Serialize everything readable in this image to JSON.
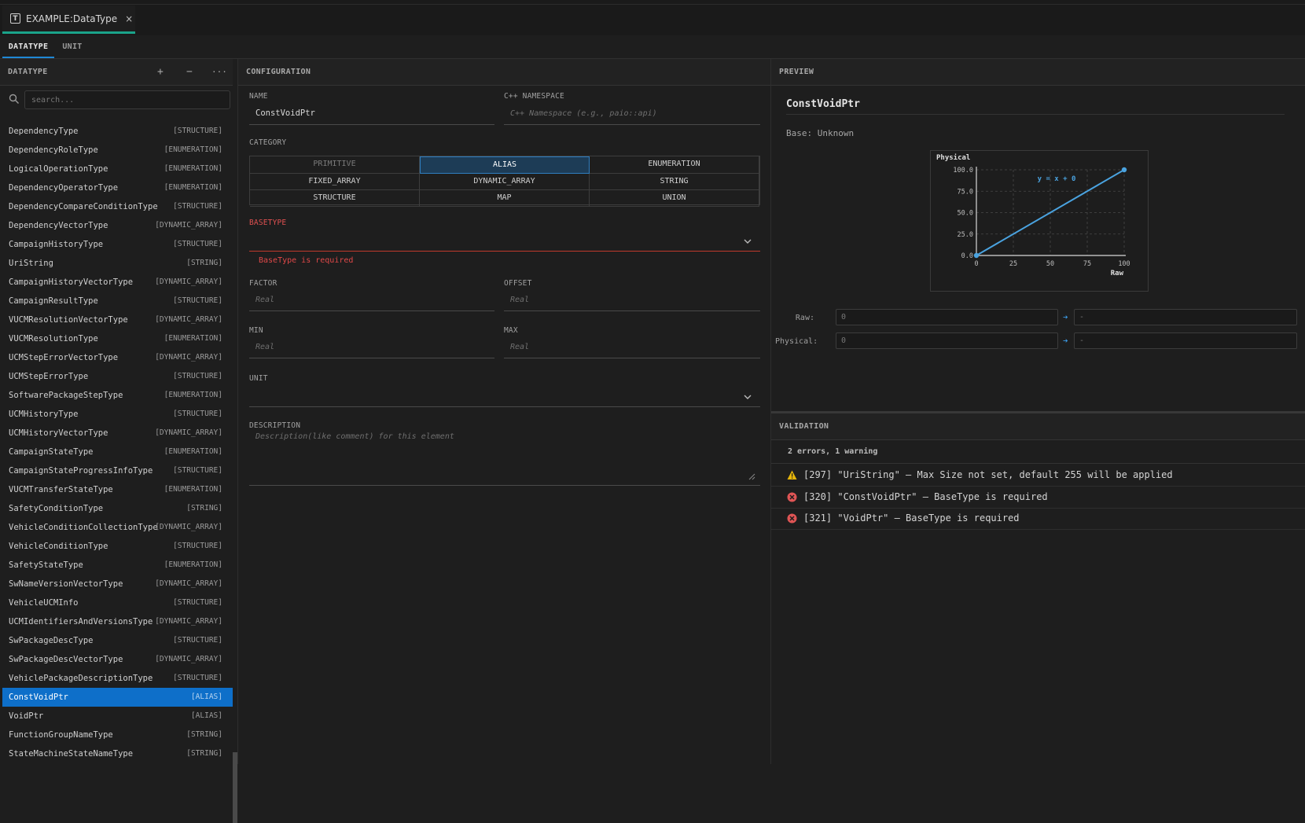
{
  "editor_tab": {
    "title": "EXAMPLE:DataType",
    "close": "×"
  },
  "subtabs": [
    "DATATYPE",
    "UNIT"
  ],
  "left": {
    "header": "DATATYPE",
    "add": "+",
    "remove": "−",
    "more": "···",
    "search_placeholder": "search...",
    "items": [
      {
        "name": "DependencyType",
        "type": "[STRUCTURE]"
      },
      {
        "name": "DependencyRoleType",
        "type": "[ENUMERATION]"
      },
      {
        "name": "LogicalOperationType",
        "type": "[ENUMERATION]"
      },
      {
        "name": "DependencyOperatorType",
        "type": "[ENUMERATION]"
      },
      {
        "name": "DependencyCompareConditionType",
        "type": "[STRUCTURE]"
      },
      {
        "name": "DependencyVectorType",
        "type": "[DYNAMIC_ARRAY]"
      },
      {
        "name": "CampaignHistoryType",
        "type": "[STRUCTURE]"
      },
      {
        "name": "UriString",
        "type": "[STRING]"
      },
      {
        "name": "CampaignHistoryVectorType",
        "type": "[DYNAMIC_ARRAY]"
      },
      {
        "name": "CampaignResultType",
        "type": "[STRUCTURE]"
      },
      {
        "name": "VUCMResolutionVectorType",
        "type": "[DYNAMIC_ARRAY]"
      },
      {
        "name": "VUCMResolutionType",
        "type": "[ENUMERATION]"
      },
      {
        "name": "UCMStepErrorVectorType",
        "type": "[DYNAMIC_ARRAY]"
      },
      {
        "name": "UCMStepErrorType",
        "type": "[STRUCTURE]"
      },
      {
        "name": "SoftwarePackageStepType",
        "type": "[ENUMERATION]"
      },
      {
        "name": "UCMHistoryType",
        "type": "[STRUCTURE]"
      },
      {
        "name": "UCMHistoryVectorType",
        "type": "[DYNAMIC_ARRAY]"
      },
      {
        "name": "CampaignStateType",
        "type": "[ENUMERATION]"
      },
      {
        "name": "CampaignStateProgressInfoType",
        "type": "[STRUCTURE]"
      },
      {
        "name": "VUCMTransferStateType",
        "type": "[ENUMERATION]"
      },
      {
        "name": "SafetyConditionType",
        "type": "[STRING]"
      },
      {
        "name": "VehicleConditionCollectionType",
        "type": "[DYNAMIC_ARRAY]"
      },
      {
        "name": "VehicleConditionType",
        "type": "[STRUCTURE]"
      },
      {
        "name": "SafetyStateType",
        "type": "[ENUMERATION]"
      },
      {
        "name": "SwNameVersionVectorType",
        "type": "[DYNAMIC_ARRAY]"
      },
      {
        "name": "VehicleUCMInfo",
        "type": "[STRUCTURE]"
      },
      {
        "name": "UCMIdentifiersAndVersionsType",
        "type": "[DYNAMIC_ARRAY]"
      },
      {
        "name": "SwPackageDescType",
        "type": "[STRUCTURE]"
      },
      {
        "name": "SwPackageDescVectorType",
        "type": "[DYNAMIC_ARRAY]"
      },
      {
        "name": "VehiclePackageDescriptionType",
        "type": "[STRUCTURE]"
      },
      {
        "name": "ConstVoidPtr",
        "type": "[ALIAS]",
        "selected": true
      },
      {
        "name": "VoidPtr",
        "type": "[ALIAS]"
      },
      {
        "name": "FunctionGroupNameType",
        "type": "[STRING]"
      },
      {
        "name": "StateMachineStateNameType",
        "type": "[STRING]"
      }
    ]
  },
  "config": {
    "header": "CONFIGURATION",
    "name_label": "NAME",
    "name_value": "ConstVoidPtr",
    "namespace_label": "C++ NAMESPACE",
    "namespace_placeholder": "C++ Namespace (e.g., paio::api)",
    "category_label": "CATEGORY",
    "categories": [
      {
        "label": "PRIMITIVE",
        "state": "disabled"
      },
      {
        "label": "ALIAS",
        "state": "active"
      },
      {
        "label": "ENUMERATION",
        "state": "normal"
      },
      {
        "label": "FIXED_ARRAY",
        "state": "normal"
      },
      {
        "label": "DYNAMIC_ARRAY",
        "state": "normal"
      },
      {
        "label": "STRING",
        "state": "normal"
      },
      {
        "label": "STRUCTURE",
        "state": "normal"
      },
      {
        "label": "MAP",
        "state": "normal"
      },
      {
        "label": "UNION",
        "state": "normal"
      }
    ],
    "basetype_label": "BASETYPE",
    "basetype_error": "BaseType is required",
    "factor_label": "FACTOR",
    "factor_placeholder": "Real",
    "offset_label": "OFFSET",
    "offset_placeholder": "Real",
    "min_label": "MIN",
    "min_placeholder": "Real",
    "max_label": "MAX",
    "max_placeholder": "Real",
    "unit_label": "UNIT",
    "description_label": "DESCRIPTION",
    "description_placeholder": "Description(like comment) for this element"
  },
  "preview": {
    "header": "PREVIEW",
    "title": "ConstVoidPtr",
    "base": "Base: Unknown",
    "raw_label": "Raw:",
    "raw_value": "0",
    "raw_result": "-",
    "physical_label": "Physical:",
    "physical_value": "0",
    "physical_result": "-",
    "arrow": "➔"
  },
  "chart_data": {
    "type": "line",
    "ylabel": "Physical",
    "xlabel": "Raw",
    "annotation": "y = x + 0",
    "x": [
      0,
      100
    ],
    "y": [
      0,
      100
    ],
    "xticks": [
      "0",
      "25",
      "50",
      "75",
      "100"
    ],
    "yticks": [
      "0.0",
      "25.0",
      "50.0",
      "75.0",
      "100.0"
    ],
    "xlim": [
      0,
      100
    ],
    "ylim": [
      0,
      100
    ],
    "grid": true,
    "line_color": "#4aa3e0"
  },
  "validation": {
    "header": "VALIDATION",
    "summary": "2 errors, 1 warning",
    "items": [
      {
        "level": "warning",
        "text": "[297] \"UriString\" – Max Size not set, default 255 will be applied"
      },
      {
        "level": "error",
        "text": "[320] \"ConstVoidPtr\" – BaseType is required"
      },
      {
        "level": "error",
        "text": "[321] \"VoidPtr\" – BaseType is required"
      }
    ]
  },
  "colors": {
    "accent": "#0e6fc9",
    "tab_indicator": "#1aa38a",
    "error": "#e04848",
    "warning": "#e5b50a"
  }
}
